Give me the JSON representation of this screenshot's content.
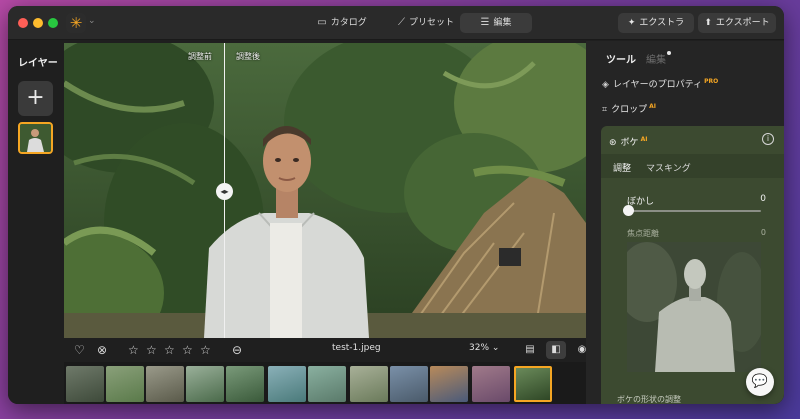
{
  "titlebar": {
    "tabs": [
      {
        "label": "カタログ",
        "icon": "folder-icon"
      },
      {
        "label": "プリセット",
        "icon": "sparkle-wand-icon"
      },
      {
        "label": "編集",
        "icon": "sliders-icon",
        "active": true
      }
    ],
    "extra_label": "エクストラ",
    "export_label": "エクスポート"
  },
  "layers": {
    "title": "レイヤー",
    "add_symbol": "+"
  },
  "canvas": {
    "before_label": "調整前",
    "after_label": "調整後"
  },
  "bottombar": {
    "filename": "test-1.jpeg",
    "zoom": "32%"
  },
  "filmstrip": {
    "count": 12,
    "selected_index": 11
  },
  "right_panel": {
    "tab_tools": "ツール",
    "tab_edit": "編集",
    "layer_props_label": "レイヤーのプロパティ",
    "layer_props_badge": "PRO",
    "crop_label": "クロップ",
    "crop_badge": "AI",
    "bokeh": {
      "title": "ボケ",
      "badge": "AI",
      "subtab_adjust": "調整",
      "subtab_masking": "マスキング",
      "blur_label": "ぼかし",
      "blur_value": "0",
      "blur_fraction": 0,
      "focus_label": "焦点距離",
      "focus_value": "0",
      "shape_label": "ボケの形状の調整"
    }
  },
  "colors": {
    "accent": "#f5a623",
    "window_bg": "#1f1f1f",
    "bokeh_card": "#3c4a30"
  }
}
